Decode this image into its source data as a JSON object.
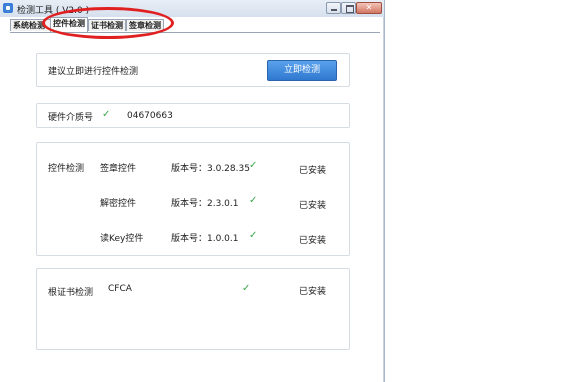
{
  "window": {
    "title": "检测工具 ( V2.0 )",
    "minimize_glyph": "",
    "close_glyph": "✕"
  },
  "tabs": [
    {
      "label": "系统检测",
      "active": false
    },
    {
      "label": "控件检测",
      "active": true
    },
    {
      "label": "证书检测",
      "active": false
    },
    {
      "label": "签章检测",
      "active": false
    }
  ],
  "annotation": {
    "color": "#e02020"
  },
  "detect": {
    "prompt": "建议立即进行控件检测",
    "button_label": "立即检测"
  },
  "hardware": {
    "label": "硬件介质号",
    "value": "04670663",
    "check": "✓"
  },
  "controls": {
    "section_label": "控件检测",
    "items": [
      {
        "name": "签章控件",
        "version": "版本号：3.0.28.35",
        "check": "✓",
        "status": "已安装"
      },
      {
        "name": "解密控件",
        "version": "版本号：2.3.0.1",
        "check": "✓",
        "status": "已安装"
      },
      {
        "name": "读Key控件",
        "version": "版本号：1.0.0.1",
        "check": "✓",
        "status": "已安装"
      }
    ]
  },
  "root_cert": {
    "label": "根证书检测",
    "name": "CFCA",
    "check": "✓",
    "status": "已安装"
  },
  "colors": {
    "accent": "#2f78cf",
    "check": "#3aa84a"
  }
}
